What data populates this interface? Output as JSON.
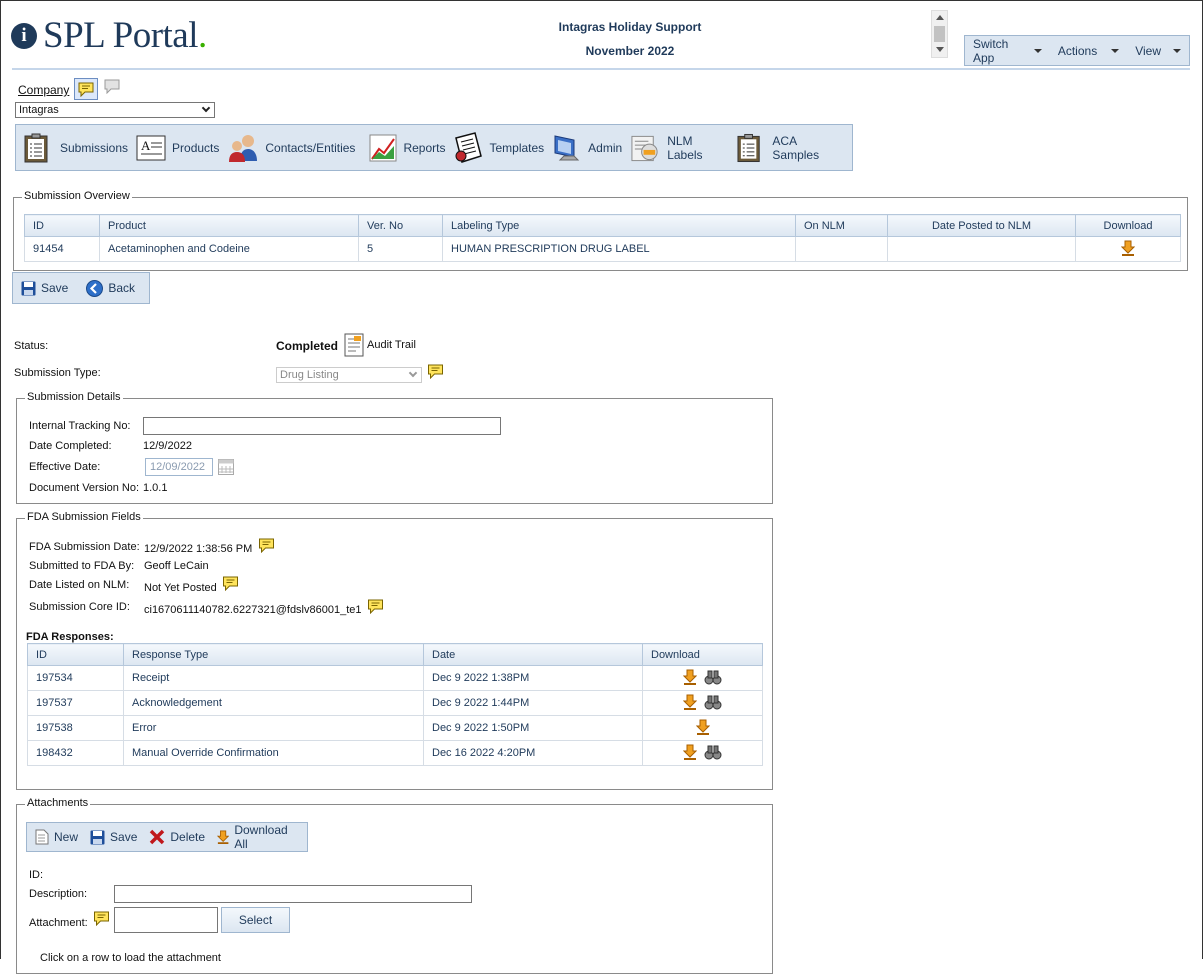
{
  "app": {
    "logo_mark": "i",
    "logo_text": "SPL Portal",
    "logo_dot": ".",
    "header_line1": "Intagras Holiday Support",
    "header_line2": "November 2022",
    "menu": [
      {
        "label": "Switch App"
      },
      {
        "label": "Actions"
      },
      {
        "label": "View"
      }
    ]
  },
  "company": {
    "label": "Company",
    "selected": "Intagras"
  },
  "nav": [
    {
      "label": "Submissions",
      "icon": "clipboard-icon"
    },
    {
      "label": "Products",
      "icon": "document-a-icon"
    },
    {
      "label": "Contacts/Entities",
      "icon": "people-icon"
    },
    {
      "label": "Reports",
      "icon": "chart-icon"
    },
    {
      "label": "Templates",
      "icon": "templates-icon"
    },
    {
      "label": "Admin",
      "icon": "monitor-icon"
    },
    {
      "label": "NLM Labels",
      "icon": "label-icon"
    },
    {
      "label": "ACA Samples",
      "icon": "clipboard-icon"
    }
  ],
  "overview": {
    "legend": "Submission Overview",
    "headers": [
      "ID",
      "Product",
      "Ver. No",
      "Labeling Type",
      "On NLM",
      "Date Posted to NLM",
      "Download"
    ],
    "row": {
      "id": "91454",
      "product": "Acetaminophen and Codeine",
      "ver": "5",
      "labeling_type": "HUMAN PRESCRIPTION DRUG LABEL",
      "on_nlm": "",
      "date_posted": ""
    }
  },
  "toolbar": {
    "save": "Save",
    "back": "Back"
  },
  "status": {
    "label": "Status:",
    "value": "Completed",
    "audit_trail": "Audit Trail",
    "type_label": "Submission Type:",
    "type_value": "Drug Listing"
  },
  "details": {
    "legend": "Submission Details",
    "tracking_label": "Internal Tracking No:",
    "tracking_value": "",
    "completed_label": "Date Completed:",
    "completed_value": "12/9/2022",
    "effective_label": "Effective Date:",
    "effective_value": "12/09/2022",
    "docver_label": "Document Version No:",
    "docver_value": "1.0.1"
  },
  "fda": {
    "legend": "FDA Submission Fields",
    "sub_date_label": "FDA Submission Date:",
    "sub_date_value": "12/9/2022 1:38:56 PM",
    "by_label": "Submitted to FDA By:",
    "by_value": "Geoff LeCain",
    "nlm_label": "Date Listed on NLM:",
    "nlm_value": "Not Yet Posted",
    "core_label": "Submission Core ID:",
    "core_value": "ci1670611140782.6227321@fdslv86001_te1",
    "responses_label": "FDA Responses:",
    "headers": [
      "ID",
      "Response Type",
      "Date",
      "Download"
    ],
    "rows": [
      {
        "id": "197534",
        "type": "Receipt",
        "date": "Dec 9 2022 1:38PM",
        "view": true
      },
      {
        "id": "197537",
        "type": "Acknowledgement",
        "date": "Dec 9 2022 1:44PM",
        "view": true
      },
      {
        "id": "197538",
        "type": "Error",
        "date": "Dec 9 2022 1:50PM",
        "view": false
      },
      {
        "id": "198432",
        "type": "Manual Override Confirmation",
        "date": "Dec 16 2022 4:20PM",
        "view": true
      }
    ]
  },
  "attachments": {
    "legend": "Attachments",
    "new": "New",
    "save": "Save",
    "delete": "Delete",
    "download_all": "Download All",
    "id_label": "ID:",
    "desc_label": "Description:",
    "attach_label": "Attachment:",
    "select_btn": "Select",
    "hint": "Click on a row to load the attachment"
  },
  "colors": {
    "brand": "#1f3a5a",
    "accent_green": "#3ab000",
    "toolbar_bg": "#dce6f1",
    "download_orange": "#f0a020"
  }
}
